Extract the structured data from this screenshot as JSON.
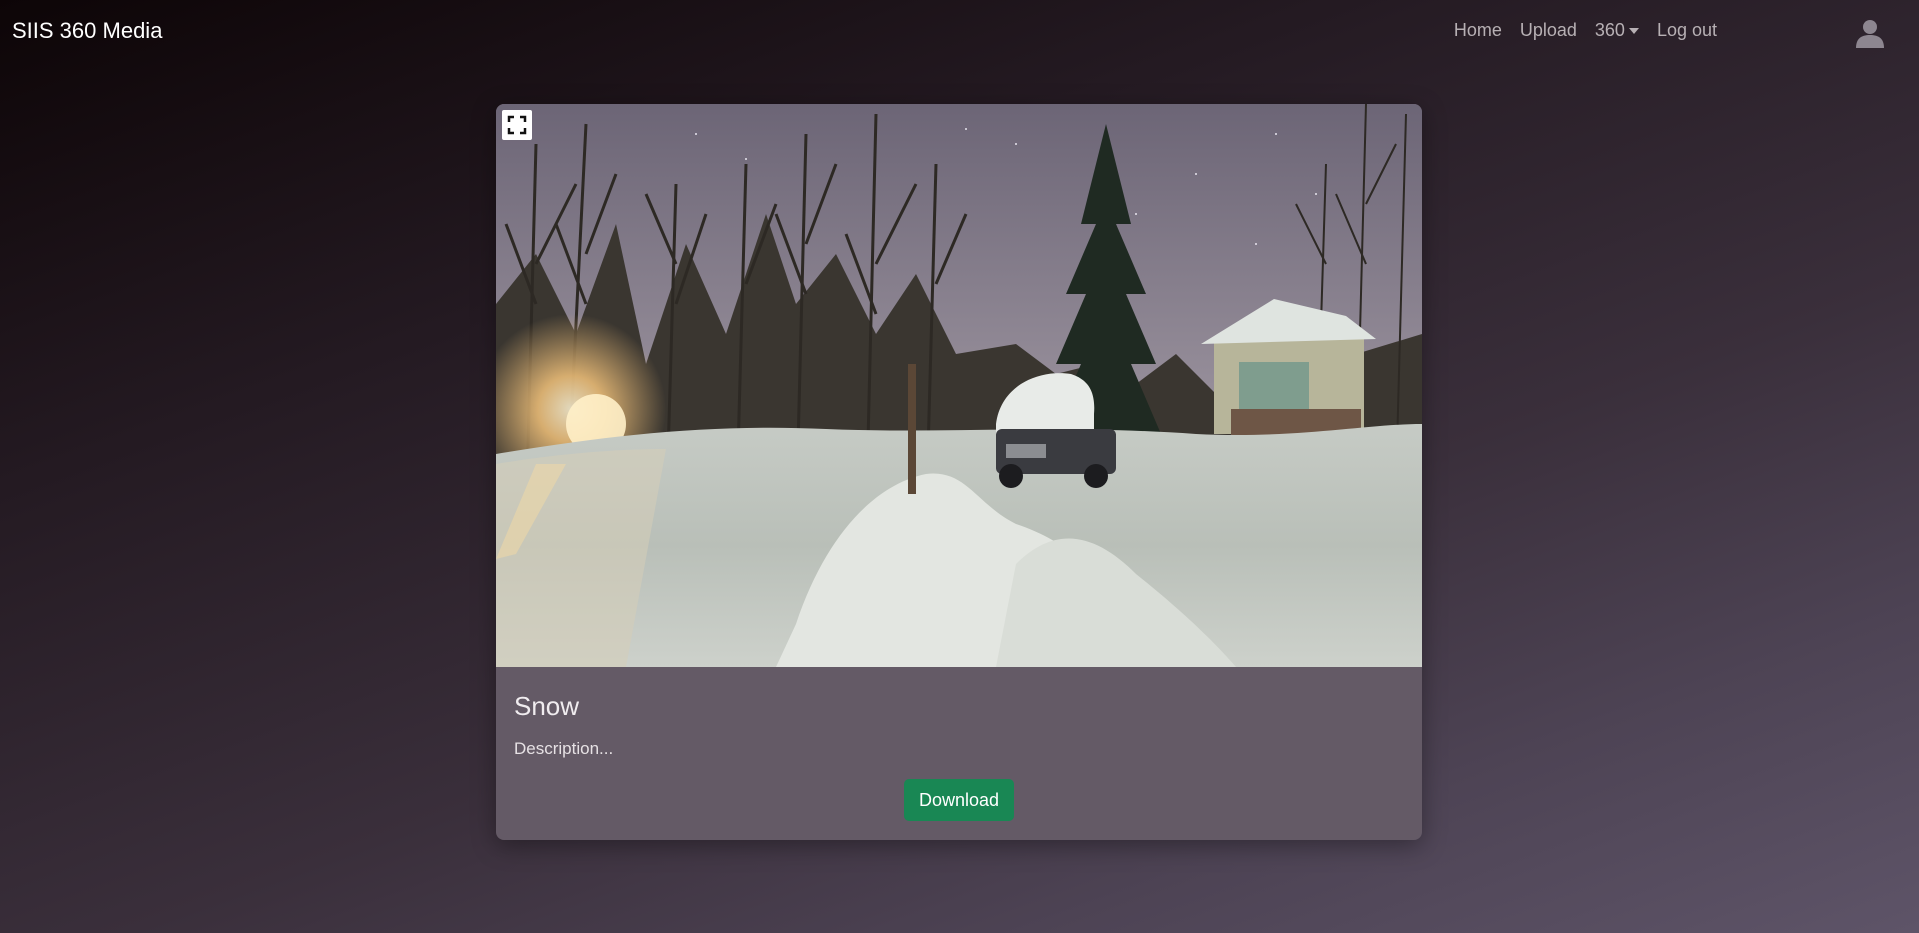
{
  "navbar": {
    "brand": "SIIS 360 Media",
    "links": {
      "home": "Home",
      "upload": "Upload",
      "menu_360": "360",
      "logout": "Log out"
    },
    "avatar_icon": "user-icon"
  },
  "viewer": {
    "fullscreen_icon": "fullscreen-icon",
    "scene": "snowy night street with trees, pickup truck and shed"
  },
  "card": {
    "title": "Snow",
    "description": "Description...",
    "download_label": "Download",
    "download_color": "#198754"
  }
}
